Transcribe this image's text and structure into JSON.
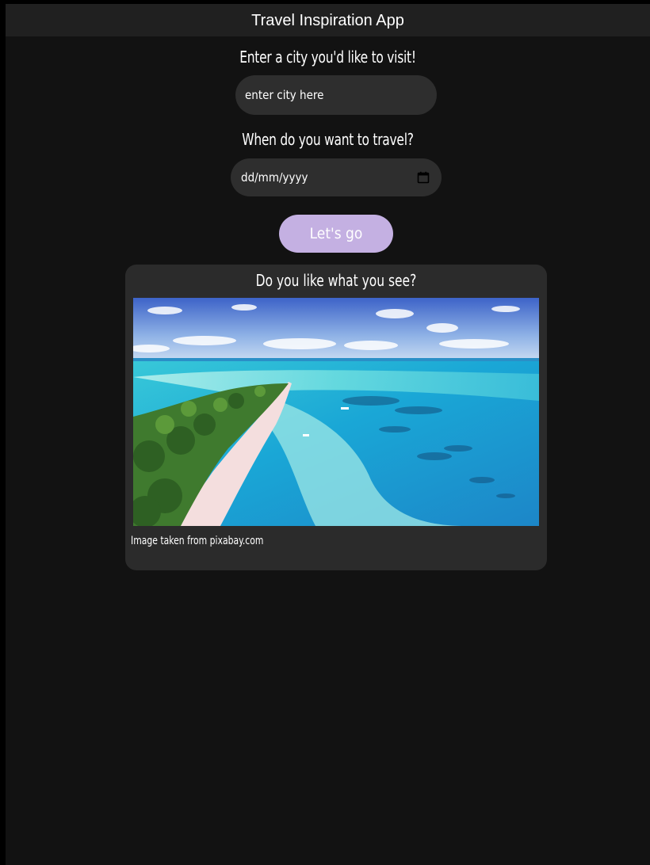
{
  "header": {
    "title": "Travel Inspiration App"
  },
  "form": {
    "city_label": "Enter a city you'd like to visit!",
    "city_placeholder": "enter city here",
    "city_value": "",
    "date_label": "When do you want to travel?",
    "date_placeholder": "dd/mm/yyyy",
    "submit_label": "Let's go"
  },
  "result": {
    "title": "Do you like what you see?",
    "image_alt": "aerial view of a tropical island beach",
    "caption": "Image taken from pixabay.com"
  },
  "icons": {
    "date_picker": "calendar-icon"
  },
  "colors": {
    "page_background": "#121212",
    "header_background": "#202020",
    "input_background": "#2e2e2e",
    "card_background": "#2b2b2b",
    "button_background": "#c4b0e2",
    "text": "#ffffff"
  }
}
